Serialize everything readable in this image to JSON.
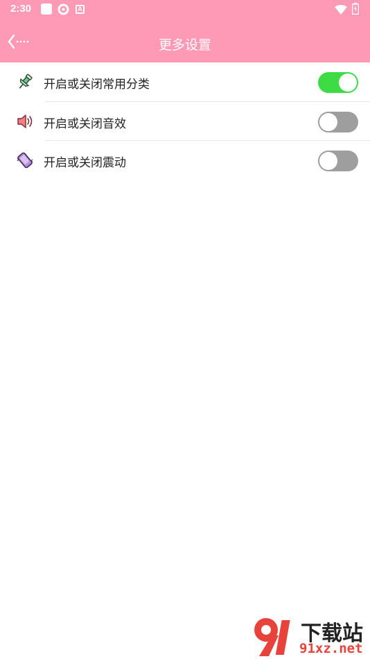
{
  "status_bar": {
    "time": "2:30",
    "icons": [
      "square-icon",
      "gear-icon",
      "a-icon",
      "wifi-icon",
      "battery-icon"
    ],
    "a_glyph": "A"
  },
  "header": {
    "back_icon": "back-chevron-icon",
    "title": "更多设置",
    "background_color": "#ff9ab6"
  },
  "settings": [
    {
      "icon": "pin-icon",
      "label": "开启或关闭常用分类",
      "enabled": true
    },
    {
      "icon": "speaker-icon",
      "label": "开启或关闭音效",
      "enabled": false
    },
    {
      "icon": "vibrate-icon",
      "label": "开启或关闭震动",
      "enabled": false
    }
  ],
  "colors": {
    "toggle_on": "#3ddc45",
    "toggle_off": "#9e9e9e"
  },
  "watermark": {
    "brand_text": "下载站",
    "domain_text": "91xz.net",
    "logo_glyph": "9"
  }
}
